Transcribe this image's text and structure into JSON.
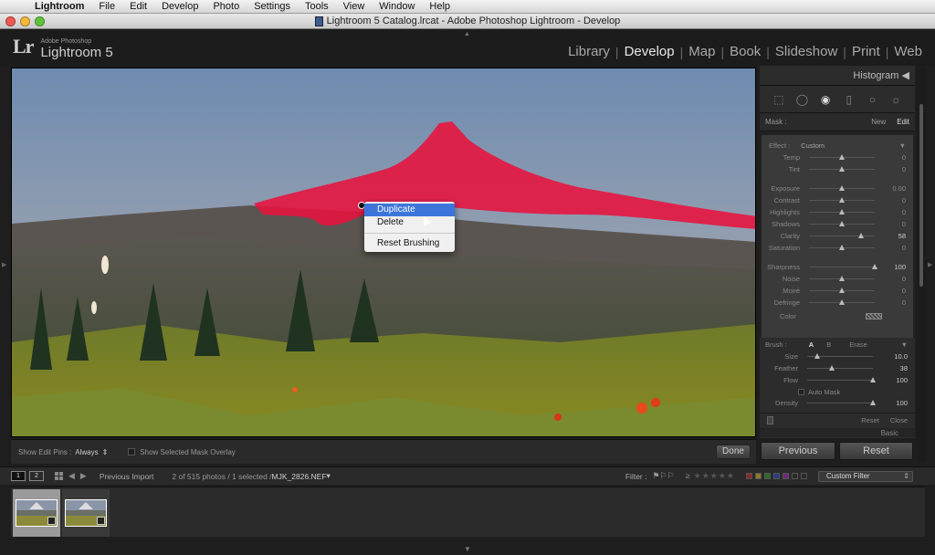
{
  "menubar": {
    "apple": "",
    "items": [
      "Lightroom",
      "File",
      "Edit",
      "Develop",
      "Photo",
      "Settings",
      "Tools",
      "View",
      "Window",
      "Help"
    ]
  },
  "window": {
    "title": "Lightroom 5 Catalog.lrcat - Adobe Photoshop Lightroom - Develop"
  },
  "identity": {
    "lr": "Lr",
    "small": "Adobe Photoshop",
    "big": "Lightroom 5"
  },
  "modules": [
    "Library",
    "Develop",
    "Map",
    "Book",
    "Slideshow",
    "Print",
    "Web"
  ],
  "active_module": "Develop",
  "context_menu": {
    "items": [
      "Duplicate",
      "Delete",
      "Reset Brushing"
    ],
    "highlighted": "Duplicate"
  },
  "toolbar": {
    "pins_label": "Show Edit Pins :",
    "pins_value": "Always",
    "overlay_label": "Show Selected Mask Overlay",
    "done": "Done"
  },
  "panel": {
    "histogram": "Histogram",
    "mask_label": "Mask :",
    "mask_new": "New",
    "mask_edit": "Edit",
    "effect_label": "Effect :",
    "effect_value": "Custom",
    "sliders": [
      {
        "label": "Temp",
        "value": "0",
        "pos": 0.5
      },
      {
        "label": "Tint",
        "value": "0",
        "pos": 0.5
      },
      {
        "label": "Exposure",
        "value": "0.00",
        "pos": 0.5
      },
      {
        "label": "Contrast",
        "value": "0",
        "pos": 0.5
      },
      {
        "label": "Highlights",
        "value": "0",
        "pos": 0.5
      },
      {
        "label": "Shadows",
        "value": "0",
        "pos": 0.5
      },
      {
        "label": "Clarity",
        "value": "58",
        "pos": 0.79
      },
      {
        "label": "Saturation",
        "value": "0",
        "pos": 0.5
      },
      {
        "label": "Sharpness",
        "value": "100",
        "pos": 1.0
      },
      {
        "label": "Noise",
        "value": "0",
        "pos": 0.5
      },
      {
        "label": "Moiré",
        "value": "0",
        "pos": 0.5
      },
      {
        "label": "Defringe",
        "value": "0",
        "pos": 0.5
      }
    ],
    "color_label": "Color",
    "brush_label": "Brush :",
    "brush_a": "A",
    "brush_b": "B",
    "brush_erase": "Erase",
    "brush_sliders": [
      {
        "label": "Size",
        "value": "10.0",
        "pos": 0.15
      },
      {
        "label": "Feather",
        "value": "38",
        "pos": 0.38
      },
      {
        "label": "Flow",
        "value": "100",
        "pos": 1.0
      }
    ],
    "auto_mask": "Auto Mask",
    "density": {
      "label": "Density",
      "value": "100",
      "pos": 1.0
    },
    "reset": "Reset",
    "close": "Close",
    "basic": "Basic"
  },
  "buttons": {
    "previous": "Previous",
    "reset": "Reset"
  },
  "filmbar": {
    "monitor1": "1",
    "monitor2": "2",
    "source": "Previous Import",
    "count": "2 of 515 photos / 1 selected /",
    "filename": "MJK_2826.NEF",
    "filter_label": "Filter :",
    "custom_filter": "Custom Filter"
  },
  "colors": {
    "mask_overlay": "#e8123c",
    "menu_highlight": "#3b75d9",
    "panel_bg": "#3a3a3a"
  }
}
